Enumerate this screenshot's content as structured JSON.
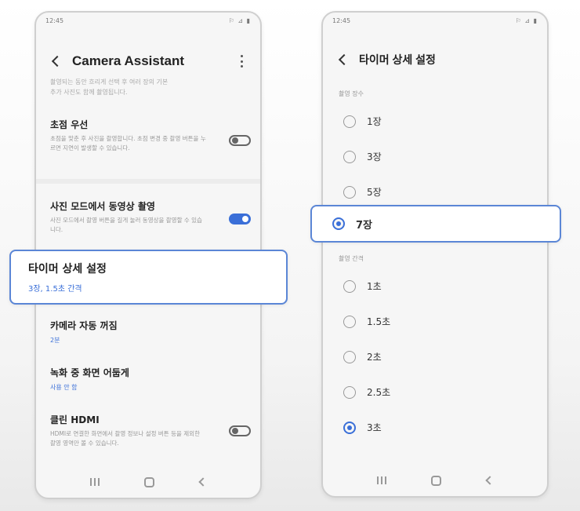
{
  "left_phone": {
    "status": {
      "time": "12:45",
      "icons": "⚐ ⊿ ▮"
    },
    "header": {
      "title": "Camera Assistant"
    },
    "faded_text": [
      "촬영되는 동안 흐리게 선택 후 여러 장의 기본",
      "추가 사진도 함께 촬영됩니다."
    ],
    "settings": [
      {
        "title": "초점 우선",
        "desc": "초점을 맞춘 후 사진을 촬영합니다. 초점 변경 중 촬영 버튼을 누르면 지연이 발생할 수 있습니다.",
        "toggle": "off"
      },
      {
        "title": "사진 모드에서 동영상 촬영",
        "desc": "사진 모드에서 촬영 버튼을 길게 눌러 동영상을 촬영할 수 있습니다.",
        "toggle": "on"
      },
      {
        "title": "카메라 자동 꺼짐",
        "value": "2분"
      },
      {
        "title": "녹화 중 화면 어둡게",
        "value": "사용 안 함"
      },
      {
        "title": "클린 HDMI",
        "desc": "HDMI로 연결한 화면에서 촬영 정보나 설정 버튼 등을 제외한 촬영 영역만 볼 수 있습니다.",
        "toggle": "off"
      }
    ]
  },
  "timer_highlight": {
    "title": "타이머 상세 설정",
    "value": "3장, 1.5초 간격"
  },
  "right_phone": {
    "status": {
      "time": "12:45",
      "icons": "⚐ ⊿ ▮"
    },
    "header": {
      "title": "타이머 상세 설정"
    },
    "shots_label": "촬영 장수",
    "shots": [
      {
        "label": "1장",
        "checked": false
      },
      {
        "label": "3장",
        "checked": false
      },
      {
        "label": "5장",
        "checked": false
      }
    ],
    "interval_label": "촬영 간격",
    "intervals": [
      {
        "label": "1초",
        "checked": false
      },
      {
        "label": "1.5초",
        "checked": false
      },
      {
        "label": "2초",
        "checked": false
      },
      {
        "label": "2.5초",
        "checked": false
      },
      {
        "label": "3초",
        "checked": true
      }
    ]
  },
  "seven_highlight": {
    "label": "7장",
    "checked": true
  },
  "colors": {
    "accent": "#3a6fd8",
    "highlight_border": "#5b86d6"
  }
}
